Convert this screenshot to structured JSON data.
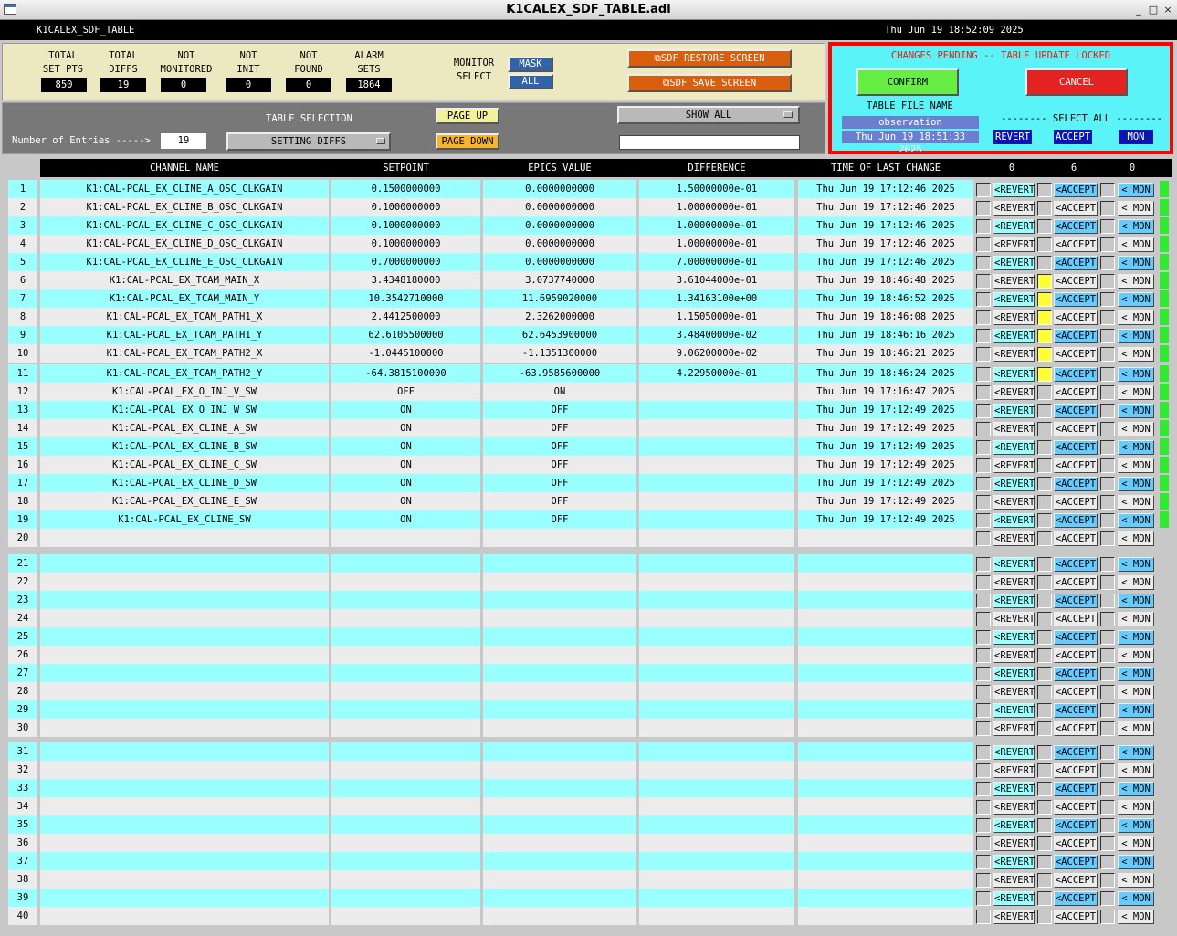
{
  "window": {
    "title": "K1CALEX_SDF_TABLE.adl",
    "minimize": "_",
    "maximize": "□",
    "close": "×"
  },
  "header": {
    "name": "K1CALEX_SDF_TABLE",
    "datetime": "Thu Jun 19 18:52:09 2025"
  },
  "stats": [
    {
      "label1": "TOTAL",
      "label2": "SET PTS",
      "value": "850"
    },
    {
      "label1": "TOTAL",
      "label2": "DIFFS",
      "value": "19"
    },
    {
      "label1": "NOT",
      "label2": "MONITORED",
      "value": "0"
    },
    {
      "label1": "NOT",
      "label2": "INIT",
      "value": "0"
    },
    {
      "label1": "NOT",
      "label2": "FOUND",
      "value": "0"
    },
    {
      "label1": "ALARM",
      "label2": "SETS",
      "value": "1864"
    }
  ],
  "monitor_select": {
    "label1": "MONITOR",
    "label2": "SELECT",
    "mask": "MASK",
    "all": "ALL"
  },
  "sdf_buttons": {
    "restore": "SDF RESTORE SCREEN",
    "save": "SDF SAVE SCREEN"
  },
  "selection": {
    "entries_label": "Number of Entries ----->",
    "entries_value": "19",
    "table_selection_label": "TABLE SELECTION",
    "table_selection_value": "SETTING DIFFS",
    "page_up": "PAGE UP",
    "page_down": "PAGE DOWN",
    "show_all": "SHOW ALL",
    "filter_value": ""
  },
  "pending": {
    "banner": "CHANGES PENDING -- TABLE UPDATE LOCKED",
    "confirm": "CONFIRM",
    "cancel": "CANCEL",
    "table_file_label": "TABLE FILE NAME",
    "table_file_name": "observation",
    "table_file_time": "Thu Jun 19 18:51:33 2025",
    "select_all_label": "-------- SELECT ALL --------",
    "revert": "REVERT",
    "accept": "ACCEPT",
    "mon": "MON"
  },
  "columns": {
    "channel": "CHANNEL NAME",
    "setpoint": "SETPOINT",
    "epics": "EPICS VALUE",
    "difference": "DIFFERENCE",
    "time": "TIME OF LAST CHANGE",
    "revert_count": "0",
    "accept_count": "6",
    "mon_count": "0"
  },
  "row_buttons": {
    "revert": "<REVERT",
    "accept": "<ACCEPT",
    "mon": "< MON"
  },
  "colors": {
    "cyan": "#99ffff",
    "grey": "#ececec",
    "yellow": "#ffff33",
    "green": "#33e833",
    "red_border": "#ff0000",
    "orange": "#d95f0e"
  },
  "rows": [
    {
      "n": "1",
      "ch": "K1:CAL-PCAL_EX_CLINE_A_OSC_CLKGAIN",
      "sp": "0.1500000000",
      "ev": "0.0000000000",
      "df": "1.50000000e-01",
      "tm": "Thu Jun 19 17:12:46 2025",
      "acc": false,
      "grn": true
    },
    {
      "n": "2",
      "ch": "K1:CAL-PCAL_EX_CLINE_B_OSC_CLKGAIN",
      "sp": "0.1000000000",
      "ev": "0.0000000000",
      "df": "1.00000000e-01",
      "tm": "Thu Jun 19 17:12:46 2025",
      "acc": false,
      "grn": true
    },
    {
      "n": "3",
      "ch": "K1:CAL-PCAL_EX_CLINE_C_OSC_CLKGAIN",
      "sp": "0.1000000000",
      "ev": "0.0000000000",
      "df": "1.00000000e-01",
      "tm": "Thu Jun 19 17:12:46 2025",
      "acc": false,
      "grn": true
    },
    {
      "n": "4",
      "ch": "K1:CAL-PCAL_EX_CLINE_D_OSC_CLKGAIN",
      "sp": "0.1000000000",
      "ev": "0.0000000000",
      "df": "1.00000000e-01",
      "tm": "Thu Jun 19 17:12:46 2025",
      "acc": false,
      "grn": true
    },
    {
      "n": "5",
      "ch": "K1:CAL-PCAL_EX_CLINE_E_OSC_CLKGAIN",
      "sp": "0.7000000000",
      "ev": "0.0000000000",
      "df": "7.00000000e-01",
      "tm": "Thu Jun 19 17:12:46 2025",
      "acc": false,
      "grn": true
    },
    {
      "n": "6",
      "ch": "K1:CAL-PCAL_EX_TCAM_MAIN_X",
      "sp": "3.4348180000",
      "ev": "3.0737740000",
      "df": "3.61044000e-01",
      "tm": "Thu Jun 19 18:46:48 2025",
      "acc": true,
      "grn": true
    },
    {
      "n": "7",
      "ch": "K1:CAL-PCAL_EX_TCAM_MAIN_Y",
      "sp": "10.3542710000",
      "ev": "11.6959020000",
      "df": "1.34163100e+00",
      "tm": "Thu Jun 19 18:46:52 2025",
      "acc": true,
      "grn": true
    },
    {
      "n": "8",
      "ch": "K1:CAL-PCAL_EX_TCAM_PATH1_X",
      "sp": "2.4412500000",
      "ev": "2.3262000000",
      "df": "1.15050000e-01",
      "tm": "Thu Jun 19 18:46:08 2025",
      "acc": true,
      "grn": true
    },
    {
      "n": "9",
      "ch": "K1:CAL-PCAL_EX_TCAM_PATH1_Y",
      "sp": "62.6105500000",
      "ev": "62.6453900000",
      "df": "3.48400000e-02",
      "tm": "Thu Jun 19 18:46:16 2025",
      "acc": true,
      "grn": true
    },
    {
      "n": "10",
      "ch": "K1:CAL-PCAL_EX_TCAM_PATH2_X",
      "sp": "-1.0445100000",
      "ev": "-1.1351300000",
      "df": "9.06200000e-02",
      "tm": "Thu Jun 19 18:46:21 2025",
      "acc": true,
      "grn": true
    },
    {
      "n": "11",
      "ch": "K1:CAL-PCAL_EX_TCAM_PATH2_Y",
      "sp": "-64.3815100000",
      "ev": "-63.9585600000",
      "df": "4.22950000e-01",
      "tm": "Thu Jun 19 18:46:24 2025",
      "acc": true,
      "grn": true
    },
    {
      "n": "12",
      "ch": "K1:CAL-PCAL_EX_O_INJ_V_SW",
      "sp": "OFF",
      "ev": "ON",
      "df": "",
      "tm": "Thu Jun 19 17:16:47 2025",
      "acc": false,
      "grn": true
    },
    {
      "n": "13",
      "ch": "K1:CAL-PCAL_EX_O_INJ_W_SW",
      "sp": "ON",
      "ev": "OFF",
      "df": "",
      "tm": "Thu Jun 19 17:12:49 2025",
      "acc": false,
      "grn": true
    },
    {
      "n": "14",
      "ch": "K1:CAL-PCAL_EX_CLINE_A_SW",
      "sp": "ON",
      "ev": "OFF",
      "df": "",
      "tm": "Thu Jun 19 17:12:49 2025",
      "acc": false,
      "grn": true
    },
    {
      "n": "15",
      "ch": "K1:CAL-PCAL_EX_CLINE_B_SW",
      "sp": "ON",
      "ev": "OFF",
      "df": "",
      "tm": "Thu Jun 19 17:12:49 2025",
      "acc": false,
      "grn": true
    },
    {
      "n": "16",
      "ch": "K1:CAL-PCAL_EX_CLINE_C_SW",
      "sp": "ON",
      "ev": "OFF",
      "df": "",
      "tm": "Thu Jun 19 17:12:49 2025",
      "acc": false,
      "grn": true
    },
    {
      "n": "17",
      "ch": "K1:CAL-PCAL_EX_CLINE_D_SW",
      "sp": "ON",
      "ev": "OFF",
      "df": "",
      "tm": "Thu Jun 19 17:12:49 2025",
      "acc": false,
      "grn": true
    },
    {
      "n": "18",
      "ch": "K1:CAL-PCAL_EX_CLINE_E_SW",
      "sp": "ON",
      "ev": "OFF",
      "df": "",
      "tm": "Thu Jun 19 17:12:49 2025",
      "acc": false,
      "grn": true
    },
    {
      "n": "19",
      "ch": "K1:CAL-PCAL_EX_CLINE_SW",
      "sp": "ON",
      "ev": "OFF",
      "df": "",
      "tm": "Thu Jun 19 17:12:49 2025",
      "acc": false,
      "grn": true
    },
    {
      "n": "20",
      "ch": "",
      "sp": "",
      "ev": "",
      "df": "",
      "tm": "",
      "acc": false,
      "grn": false
    },
    {
      "n": "21",
      "ch": "",
      "sp": "",
      "ev": "",
      "df": "",
      "tm": "",
      "acc": false,
      "grn": false
    },
    {
      "n": "22",
      "ch": "",
      "sp": "",
      "ev": "",
      "df": "",
      "tm": "",
      "acc": false,
      "grn": false
    },
    {
      "n": "23",
      "ch": "",
      "sp": "",
      "ev": "",
      "df": "",
      "tm": "",
      "acc": false,
      "grn": false
    },
    {
      "n": "24",
      "ch": "",
      "sp": "",
      "ev": "",
      "df": "",
      "tm": "",
      "acc": false,
      "grn": false
    },
    {
      "n": "25",
      "ch": "",
      "sp": "",
      "ev": "",
      "df": "",
      "tm": "",
      "acc": false,
      "grn": false
    },
    {
      "n": "26",
      "ch": "",
      "sp": "",
      "ev": "",
      "df": "",
      "tm": "",
      "acc": false,
      "grn": false
    },
    {
      "n": "27",
      "ch": "",
      "sp": "",
      "ev": "",
      "df": "",
      "tm": "",
      "acc": false,
      "grn": false
    },
    {
      "n": "28",
      "ch": "",
      "sp": "",
      "ev": "",
      "df": "",
      "tm": "",
      "acc": false,
      "grn": false
    },
    {
      "n": "29",
      "ch": "",
      "sp": "",
      "ev": "",
      "df": "",
      "tm": "",
      "acc": false,
      "grn": false
    },
    {
      "n": "30",
      "ch": "",
      "sp": "",
      "ev": "",
      "df": "",
      "tm": "",
      "acc": false,
      "grn": false
    },
    {
      "n": "31",
      "ch": "",
      "sp": "",
      "ev": "",
      "df": "",
      "tm": "",
      "acc": false,
      "grn": false
    },
    {
      "n": "32",
      "ch": "",
      "sp": "",
      "ev": "",
      "df": "",
      "tm": "",
      "acc": false,
      "grn": false
    },
    {
      "n": "33",
      "ch": "",
      "sp": "",
      "ev": "",
      "df": "",
      "tm": "",
      "acc": false,
      "grn": false
    },
    {
      "n": "34",
      "ch": "",
      "sp": "",
      "ev": "",
      "df": "",
      "tm": "",
      "acc": false,
      "grn": false
    },
    {
      "n": "35",
      "ch": "",
      "sp": "",
      "ev": "",
      "df": "",
      "tm": "",
      "acc": false,
      "grn": false
    },
    {
      "n": "36",
      "ch": "",
      "sp": "",
      "ev": "",
      "df": "",
      "tm": "",
      "acc": false,
      "grn": false
    },
    {
      "n": "37",
      "ch": "",
      "sp": "",
      "ev": "",
      "df": "",
      "tm": "",
      "acc": false,
      "grn": false
    },
    {
      "n": "38",
      "ch": "",
      "sp": "",
      "ev": "",
      "df": "",
      "tm": "",
      "acc": false,
      "grn": false
    },
    {
      "n": "39",
      "ch": "",
      "sp": "",
      "ev": "",
      "df": "",
      "tm": "",
      "acc": false,
      "grn": false
    },
    {
      "n": "40",
      "ch": "",
      "sp": "",
      "ev": "",
      "df": "",
      "tm": "",
      "acc": false,
      "grn": false
    }
  ]
}
